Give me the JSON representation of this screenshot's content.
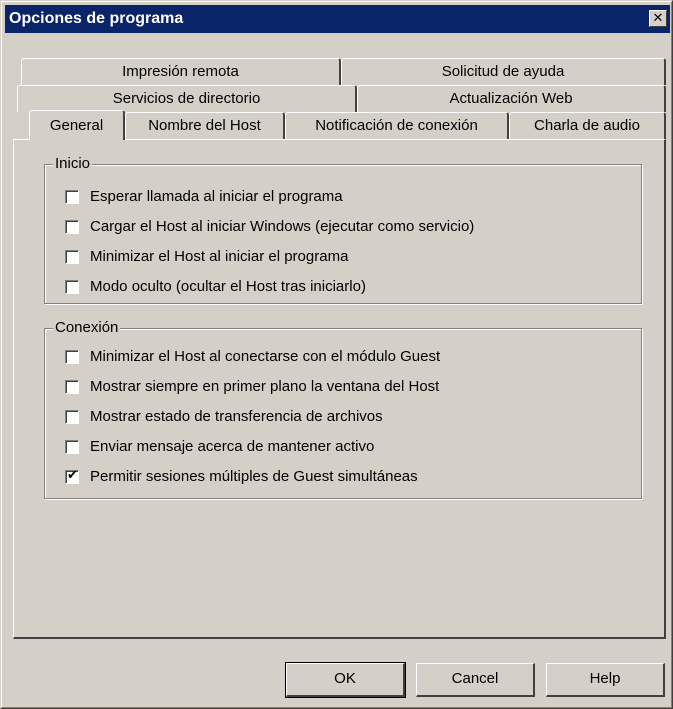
{
  "window": {
    "title": "Opciones de programa",
    "close_glyph": "✕",
    "title_bar_color": "#0a246a",
    "face_color": "#d4d0c8"
  },
  "tabs": {
    "row1": [
      {
        "label": "Impresión remota"
      },
      {
        "label": "Solicitud de ayuda"
      }
    ],
    "row2": [
      {
        "label": "Servicios de directorio"
      },
      {
        "label": "Actualización Web"
      }
    ],
    "row3": [
      {
        "label": "General",
        "active": true
      },
      {
        "label": "Nombre del Host"
      },
      {
        "label": "Notificación de conexión"
      },
      {
        "label": "Charla de audio"
      }
    ]
  },
  "groups": {
    "inicio": {
      "label": "Inicio",
      "options": [
        {
          "label": "Esperar llamada al iniciar el programa",
          "checked": false
        },
        {
          "label": "Cargar el Host al iniciar Windows (ejecutar como servicio)",
          "checked": false
        },
        {
          "label": "Minimizar el Host al iniciar el programa",
          "checked": false
        },
        {
          "label": "Modo oculto (ocultar el Host tras iniciarlo)",
          "checked": false
        }
      ]
    },
    "conexion": {
      "label": "Conexión",
      "options": [
        {
          "label": "Minimizar el Host al conectarse con el módulo Guest",
          "checked": false
        },
        {
          "label": "Mostrar siempre en primer plano la ventana del Host",
          "checked": false
        },
        {
          "label": "Mostrar estado de transferencia de archivos",
          "checked": false
        },
        {
          "label": "Enviar mensaje acerca de mantener activo",
          "checked": false
        },
        {
          "label": "Permitir sesiones múltiples de Guest simultáneas",
          "checked": true
        }
      ]
    }
  },
  "check_glyph": "✔",
  "buttons": {
    "ok": "OK",
    "cancel": "Cancel",
    "help": "Help"
  }
}
